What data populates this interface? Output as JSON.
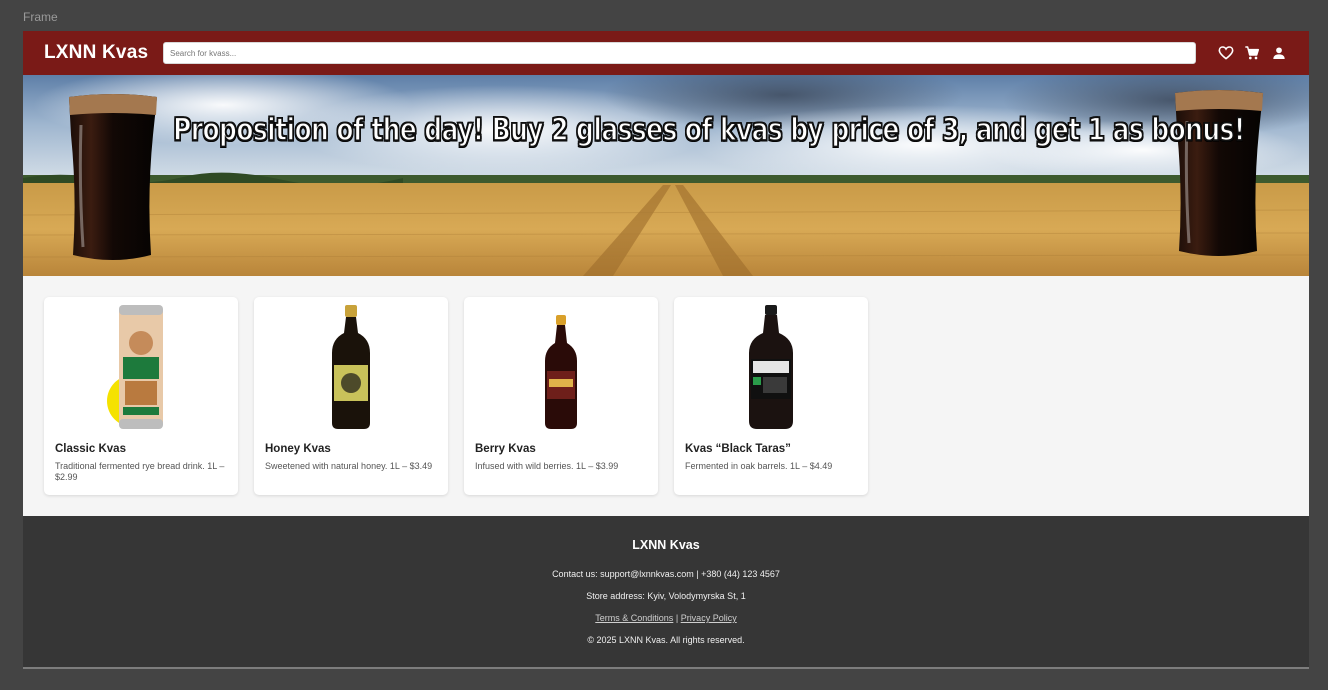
{
  "frame": {
    "label": "Frame"
  },
  "header": {
    "logo": "LXNN Kvas",
    "search": {
      "placeholder": "Search for kvass...",
      "value": ""
    },
    "icons": [
      "heart-icon",
      "cart-icon",
      "user-icon"
    ],
    "background": "#7a1a17"
  },
  "hero": {
    "text": "Proposition of the day! Buy 2 glasses of kvas by price of 3, and get 1 as bonus!"
  },
  "products": [
    {
      "name": "Classic Kvas",
      "description": "Traditional fermented rye bread drink. 1L – $2.99"
    },
    {
      "name": "Honey Kvas",
      "description": "Sweetened with natural honey. 1L – $3.49"
    },
    {
      "name": "Berry Kvas",
      "description": "Infused with wild berries. 1L – $3.99"
    },
    {
      "name": "Kvas “Black Taras”",
      "description": "Fermented in oak barrels. 1L – $4.49"
    }
  ],
  "footer": {
    "title": "LXNN Kvas",
    "contact": "Contact us: support@lxnnkvas.com | +380 (44) 123 4567",
    "address": "Store address: Kyiv, Volodymyrska St, 1",
    "terms_label": "Terms & Conditions",
    "separator": "|",
    "privacy_label": "Privacy Policy",
    "copyright": "© 2025 LXNN Kvas. All rights reserved.",
    "background": "#363636"
  }
}
